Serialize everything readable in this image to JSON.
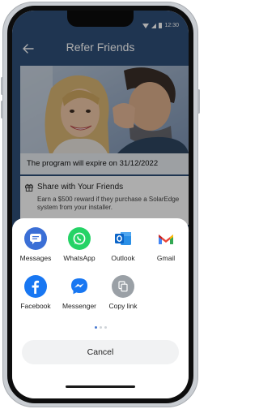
{
  "status_bar": {
    "time": "12:30"
  },
  "header": {
    "title": "Refer Friends"
  },
  "banner": {
    "expiry_text": "The program will expire on 31/12/2022"
  },
  "share_section": {
    "title": "Share with Your Friends",
    "description": "Earn a $500 reward if they purchase a SolarEdge system from your installer."
  },
  "share_sheet": {
    "targets": [
      {
        "label": "Messages",
        "icon": "messages-icon",
        "color": "#3b6fd6"
      },
      {
        "label": "WhatsApp",
        "icon": "whatsapp-icon",
        "color": "#25d366"
      },
      {
        "label": "Outlook",
        "icon": "outlook-icon",
        "color": "#0a64c8"
      },
      {
        "label": "Gmail",
        "icon": "gmail-icon",
        "color": "#d93025"
      },
      {
        "label": "Facebook",
        "icon": "facebook-icon",
        "color": "#1877f2"
      },
      {
        "label": "Messenger",
        "icon": "messenger-icon",
        "color": "#1877f2"
      },
      {
        "label": "Copy link",
        "icon": "copy-link-icon",
        "color": "#9aa0a6"
      }
    ],
    "page_indicator": {
      "pages": 3,
      "active": 1
    },
    "cancel_label": "Cancel"
  }
}
